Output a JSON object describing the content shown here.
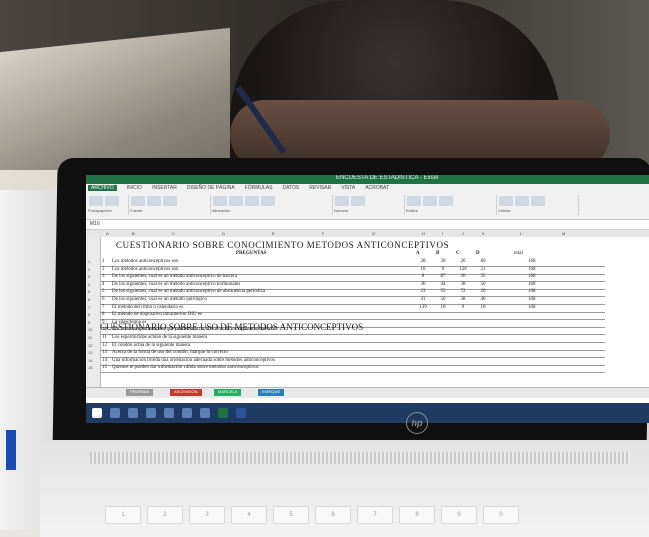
{
  "photo": {
    "description_colors": {
      "bezel": "#101010",
      "excel_green": "#217346",
      "taskbar": "#1f3b63"
    },
    "brand_logo": "hp"
  },
  "excel": {
    "app_title": "ENCUESTA DE ESTADISTICA - Excel",
    "menu_tabs": [
      "ARCHIVO",
      "INICIO",
      "INSERTAR",
      "DISEÑO DE PÁGINA",
      "FÓRMULAS",
      "DATOS",
      "REVISAR",
      "VISTA",
      "ACROBAT"
    ],
    "ribbon_groups": [
      "Portapapeles",
      "Fuente",
      "Alineación",
      "Número",
      "Estilos",
      "Celdas"
    ],
    "name_box": "M16",
    "columns": [
      "A",
      "B",
      "C",
      "D",
      "E",
      "F",
      "G",
      "H",
      "I",
      "J",
      "K",
      "L",
      "M"
    ],
    "questionnaire_title": "CUESTIONARIO SOBRE CONOCIMIENTO METODOS ANTICONCEPTIVOS",
    "preguntas_header": "PREGUNTAS",
    "answer_headers": [
      "A",
      "B",
      "C",
      "D"
    ],
    "total_header": "total",
    "rows": [
      {
        "n": "1",
        "text": "Los métodos anticonceptivos son",
        "a": "38",
        "b": "30",
        "c": "20",
        "d": "80",
        "total": "168"
      },
      {
        "n": "2",
        "text": "Los métodos anticonceptivos son",
        "a": "10",
        "b": "9",
        "c": "128",
        "d": "21",
        "total": "168"
      },
      {
        "n": "3",
        "text": "De los siguientes, cual es un método anticonceptivo de barrera",
        "a": "8",
        "b": "87",
        "c": "36",
        "d": "35",
        "total": "168"
      },
      {
        "n": "4",
        "text": "De los siguientes, cual es un método anticonceptivo hormonales",
        "a": "36",
        "b": "44",
        "c": "38",
        "d": "50",
        "total": "168"
      },
      {
        "n": "5",
        "text": "De los siguientes, cual es un método anticonceptivo de abstinencia periódica",
        "a": "23",
        "b": "55",
        "c": "72",
        "d": "20",
        "total": "168"
      },
      {
        "n": "6",
        "text": "De los siguientes, cual es un método quirúrgico",
        "a": "41",
        "b": "50",
        "c": "38",
        "d": "40",
        "total": "168"
      },
      {
        "n": "7",
        "text": "El método del ritmo o calendario es",
        "a": "139",
        "b": "10",
        "c": "9",
        "d": "10",
        "total": "168"
      },
      {
        "n": "8",
        "text": "El método de dispositivo intrauterino DIU es",
        "a": "",
        "b": "",
        "c": "",
        "d": "",
        "total": ""
      },
      {
        "n": "9",
        "text": "La vasectomía es",
        "a": "",
        "b": "",
        "c": "",
        "d": "",
        "total": ""
      },
      {
        "n": "10",
        "text": "Los anticonceptivos orales que pueden afectar la acción de los siguientes métodos",
        "a": "",
        "b": "",
        "c": "",
        "d": "",
        "total": ""
      },
      {
        "n": "11",
        "text": "Los espermicidas actúan de la siguiente manera",
        "a": "",
        "b": "",
        "c": "",
        "d": "",
        "total": ""
      },
      {
        "n": "12",
        "text": "El condón actúa de la siguiente manera",
        "a": "",
        "b": "",
        "c": "",
        "d": "",
        "total": ""
      },
      {
        "n": "13",
        "text": "Acerca de la forma de uso del condón, marque lo correcto",
        "a": "",
        "b": "",
        "c": "",
        "d": "",
        "total": ""
      },
      {
        "n": "14",
        "text": "Una información brinda una orientación adecuada sobre métodos anticonceptivos",
        "a": "",
        "b": "",
        "c": "",
        "d": "",
        "total": ""
      },
      {
        "n": "15",
        "text": "Quienes te pueden dar información válida sobre métodos anticonceptivos",
        "a": "",
        "b": "",
        "c": "",
        "d": "",
        "total": ""
      }
    ],
    "second_title": "CUESTIONARIO SOBRE USO DE METODOS ANTICONCEPTIVOS",
    "sheet_tabs": [
      {
        "label": "PRUEBAS",
        "color": "#9a9a9a"
      },
      {
        "label": "ASCENSION",
        "color": "#c0392b"
      },
      {
        "label": "MARCELA",
        "color": "#27ae60"
      },
      {
        "label": "ENRIQUE",
        "color": "#2980b9"
      }
    ]
  },
  "keyboard": {
    "digit_keys": [
      "1",
      "2",
      "3",
      "4",
      "5",
      "6",
      "7",
      "8",
      "9",
      "0"
    ]
  }
}
